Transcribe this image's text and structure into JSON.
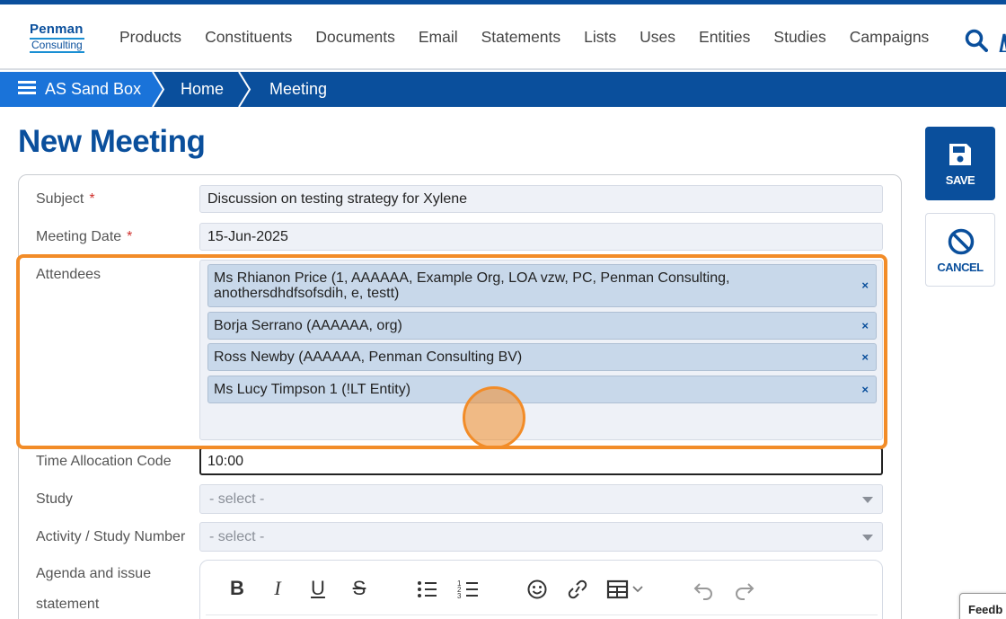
{
  "brand": {
    "line1": "Penman",
    "line2": "Consulting"
  },
  "nav": [
    "Products",
    "Constituents",
    "Documents",
    "Email",
    "Statements",
    "Lists",
    "Uses",
    "Entities",
    "Studies",
    "Campaigns"
  ],
  "breadcrumb": {
    "root": "AS Sand Box",
    "items": [
      "Home",
      "Meeting"
    ]
  },
  "page": {
    "title": "New Meeting"
  },
  "actions": {
    "save": "SAVE",
    "cancel": "CANCEL"
  },
  "form": {
    "subject": {
      "label": "Subject",
      "required_mark": "*",
      "value": "Discussion on testing strategy for Xylene"
    },
    "meeting_date": {
      "label": "Meeting Date",
      "required_mark": "*",
      "value": "15-Jun-2025"
    },
    "attendees": {
      "label": "Attendees",
      "tags": [
        "Ms Rhianon Price (1, AAAAAA, Example Org, LOA vzw, PC, Penman Consulting, anothersdhdfsofsdih, e, testt)",
        "Borja Serrano (AAAAAA, org)",
        "Ross Newby (AAAAAA, Penman Consulting BV)",
        "Ms Lucy Timpson 1 (!LT Entity)"
      ],
      "remove_symbol": "×"
    },
    "time_allocation": {
      "label": "Time Allocation Code",
      "value": "10:00"
    },
    "study": {
      "label": "Study",
      "placeholder": "- select -"
    },
    "activity": {
      "label": "Activity / Study Number",
      "placeholder": "- select -"
    },
    "agenda": {
      "label_line1": "Agenda and issue",
      "label_line2": "statement"
    }
  },
  "feedback": {
    "label": "Feedb"
  },
  "colors": {
    "primary": "#0a4f9c",
    "accent": "#1a73d9",
    "highlight": "#f28c28",
    "tag_bg": "#c8d8ea"
  }
}
